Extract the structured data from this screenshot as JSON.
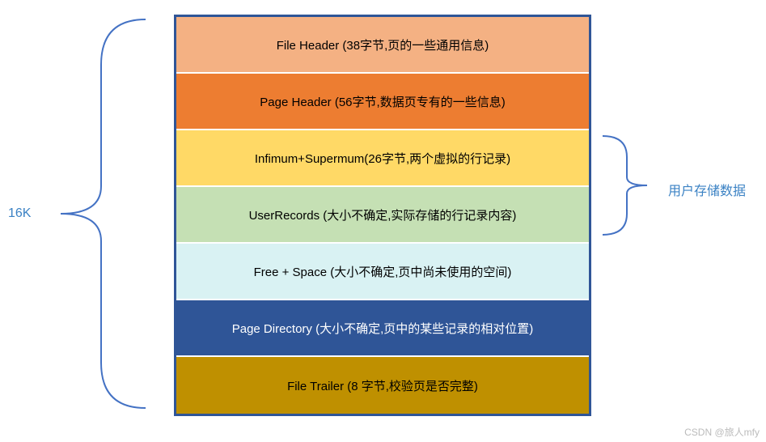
{
  "left_label": "16K",
  "right_label": "用户存储数据",
  "rows": [
    {
      "label": "File Header (38字节,页的一些通用信息)"
    },
    {
      "label": "Page Header (56字节,数据页专有的一些信息)"
    },
    {
      "label": "Infimum+Supermum(26字节,两个虚拟的行记录)"
    },
    {
      "label": "UserRecords (大小不确定,实际存储的行记录内容)"
    },
    {
      "label": "Free + Space (大小不确定,页中尚未使用的空间)"
    },
    {
      "label": "Page Directory (大小不确定,页中的某些记录的相对位置)"
    },
    {
      "label": "File Trailer (8 字节,校验页是否完整)"
    }
  ],
  "watermark": "CSDN @旅人mfy"
}
